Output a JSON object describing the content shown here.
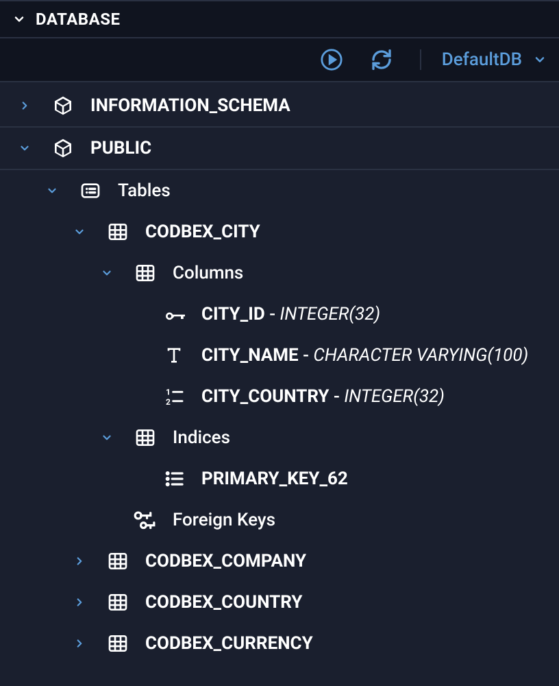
{
  "panel": {
    "title": "DATABASE"
  },
  "toolbar": {
    "selected_db": "DefaultDB"
  },
  "schemas": [
    {
      "name": "INFORMATION_SCHEMA",
      "expanded": false
    },
    {
      "name": "PUBLIC",
      "expanded": true
    }
  ],
  "groups": {
    "tables": "Tables",
    "columns": "Columns",
    "indices": "Indices",
    "foreign_keys": "Foreign Keys"
  },
  "tables": [
    {
      "name": "CODBEX_CITY",
      "expanded": true
    },
    {
      "name": "CODBEX_COMPANY",
      "expanded": false
    },
    {
      "name": "CODBEX_COUNTRY",
      "expanded": false
    },
    {
      "name": "CODBEX_CURRENCY",
      "expanded": false
    }
  ],
  "columns": [
    {
      "name": "CITY_ID",
      "type": "INTEGER(32)",
      "kind": "key"
    },
    {
      "name": "CITY_NAME",
      "type": "CHARACTER VARYING(100)",
      "kind": "text"
    },
    {
      "name": "CITY_COUNTRY",
      "type": "INTEGER(32)",
      "kind": "number"
    }
  ],
  "indices": [
    {
      "name": "PRIMARY_KEY_62"
    }
  ]
}
